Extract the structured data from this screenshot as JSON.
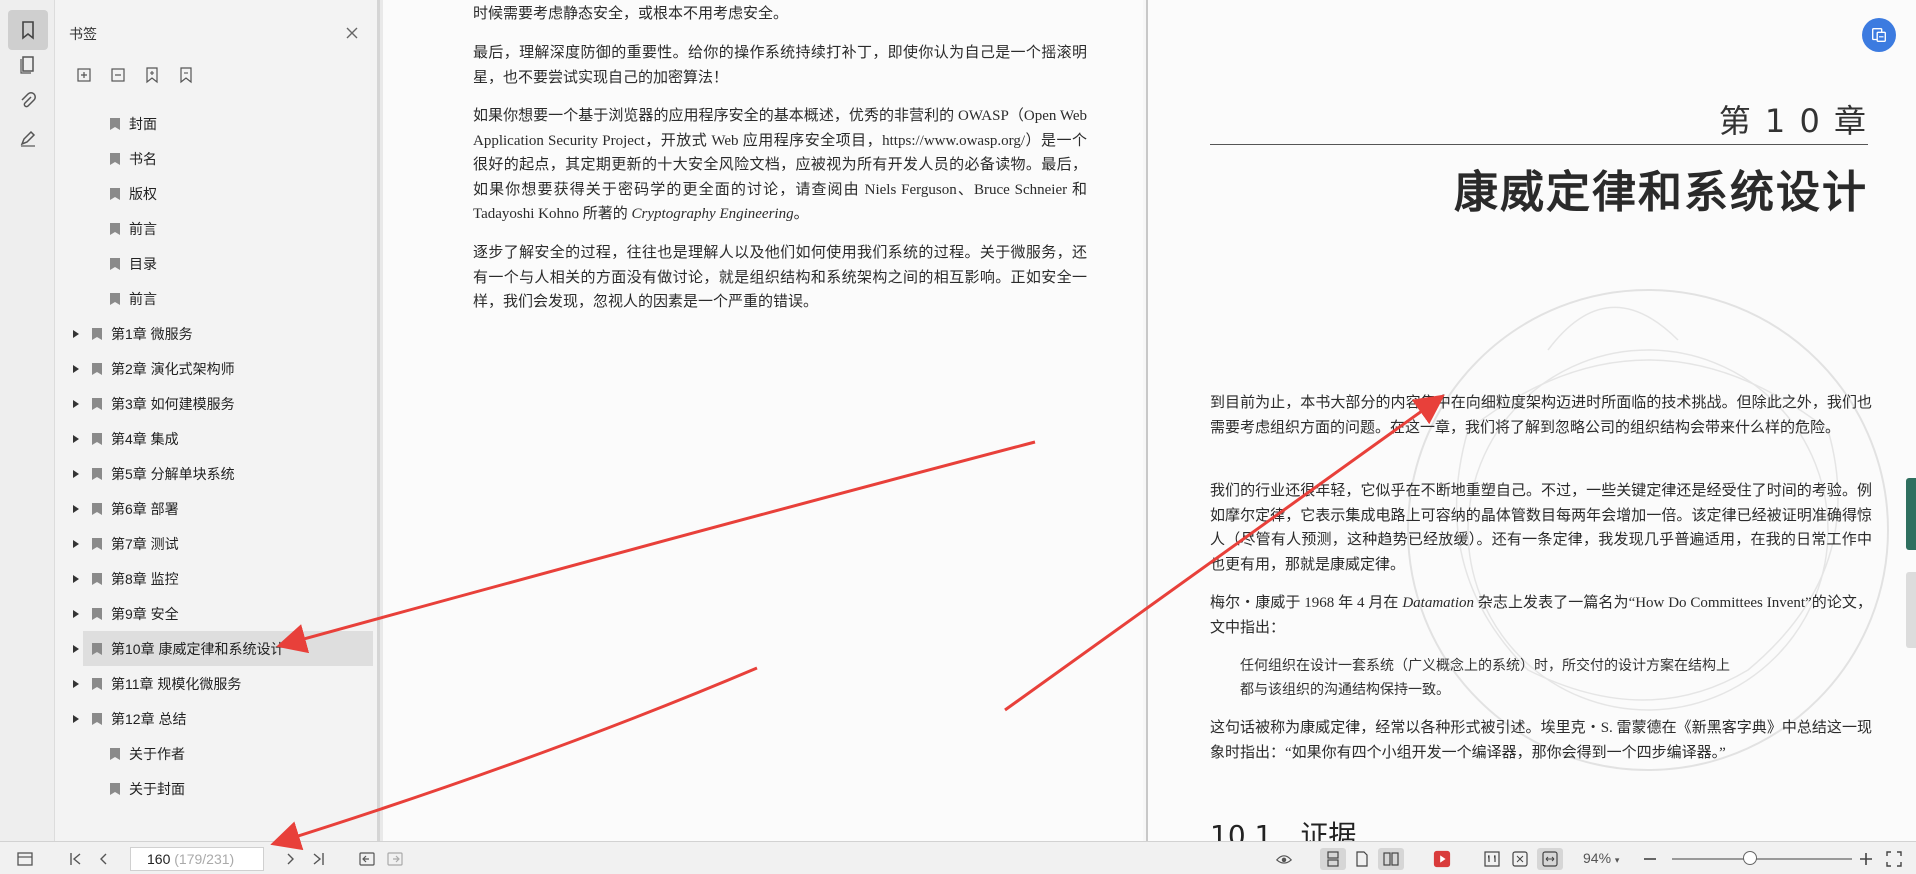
{
  "sidebar_panel": {
    "title": "书签",
    "items": [
      {
        "label": "封面",
        "expandable": false
      },
      {
        "label": "书名",
        "expandable": false
      },
      {
        "label": "版权",
        "expandable": false
      },
      {
        "label": "前言",
        "expandable": false
      },
      {
        "label": "目录",
        "expandable": false
      },
      {
        "label": "前言",
        "expandable": false
      },
      {
        "label": "第1章 微服务",
        "expandable": true
      },
      {
        "label": "第2章 演化式架构师",
        "expandable": true
      },
      {
        "label": "第3章 如何建模服务",
        "expandable": true
      },
      {
        "label": "第4章 集成",
        "expandable": true
      },
      {
        "label": "第5章 分解单块系统",
        "expandable": true
      },
      {
        "label": "第6章 部署",
        "expandable": true
      },
      {
        "label": "第7章 测试",
        "expandable": true
      },
      {
        "label": "第8章 监控",
        "expandable": true
      },
      {
        "label": "第9章 安全",
        "expandable": true
      },
      {
        "label": "第10章 康威定律和系统设计",
        "expandable": true,
        "selected": true
      },
      {
        "label": "第11章 规模化微服务",
        "expandable": true
      },
      {
        "label": "第12章 总结",
        "expandable": true
      },
      {
        "label": "关于作者",
        "expandable": false
      },
      {
        "label": "关于封面",
        "expandable": false
      }
    ]
  },
  "left_page": {
    "p0": "时候需要考虑静态安全，或根本不用考虑安全。",
    "p1": "最后，理解深度防御的重要性。给你的操作系统持续打补丁，即使你认为自己是一个摇滚明星，也不要尝试实现自己的加密算法！",
    "p2_a": "如果你想要一个基于浏览器的应用程序安全的基本概述，优秀的非营利的 OWASP（Open Web Application Security Project，开放式 Web 应用程序安全项目，https://www.owasp.org/）是一个很好的起点，其定期更新的十大安全风险文档，应被视为所有开发人员的必备读物。最后，如果你想要获得关于密码学的更全面的讨论，请查阅由 Niels Ferguson、Bruce Schneier 和 Tadayoshi Kohno 所著的 ",
    "p2_em": "Cryptography Engineering",
    "p2_b": "。",
    "p3": "逐步了解安全的过程，往往也是理解人以及他们如何使用我们系统的过程。关于微服务，还有一个与人相关的方面没有做讨论，就是组织结构和系统架构之间的相互影响。正如安全一样，我们会发现，忽视人的因素是一个严重的错误。"
  },
  "right_page": {
    "chapter_number": "第 1 0 章",
    "chapter_title": "康威定律和系统设计",
    "p1": "到目前为止，本书大部分的内容集中在向细粒度架构迈进时所面临的技术挑战。但除此之外，我们也需要考虑组织方面的问题。在这一章，我们将了解到忽略公司的组织结构会带来什么样的危险。",
    "p2": "我们的行业还很年轻，它似乎在不断地重塑自己。不过，一些关键定律还是经受住了时间的考验。例如摩尔定律，它表示集成电路上可容纳的晶体管数目每两年会增加一倍。该定律已经被证明准确得惊人（尽管有人预测，这种趋势已经放缓）。还有一条定律，我发现几乎普遍适用，在我的日常工作中也更有用，那就是康威定律。",
    "p3_a": "梅尔・康威于 1968 年 4 月在 ",
    "p3_em": "Datamation",
    "p3_b": " 杂志上发表了一篇名为“How Do Committees Invent”的论文，文中指出：",
    "quote_line1": "任何组织在设计一套系统（广义概念上的系统）时，所交付的设计方案在结构上",
    "quote_line2": "都与该组织的沟通结构保持一致。",
    "p4": "这句话被称为康威定律，经常以各种形式被引述。埃里克・S. 雷蒙德在《新黑客字典》中总结这一现象时指出：“如果你有四个小组开发一个编译器，那你会得到一个四步编译器。”",
    "section_heading": "10.1　证据"
  },
  "bottom_bar": {
    "page_current": "160",
    "page_total": " (179/231)",
    "zoom": "94%"
  },
  "colors": {
    "arrow": "#e8403a",
    "accent_blue": "#3c7be0",
    "play_red": "#d93b3b"
  }
}
